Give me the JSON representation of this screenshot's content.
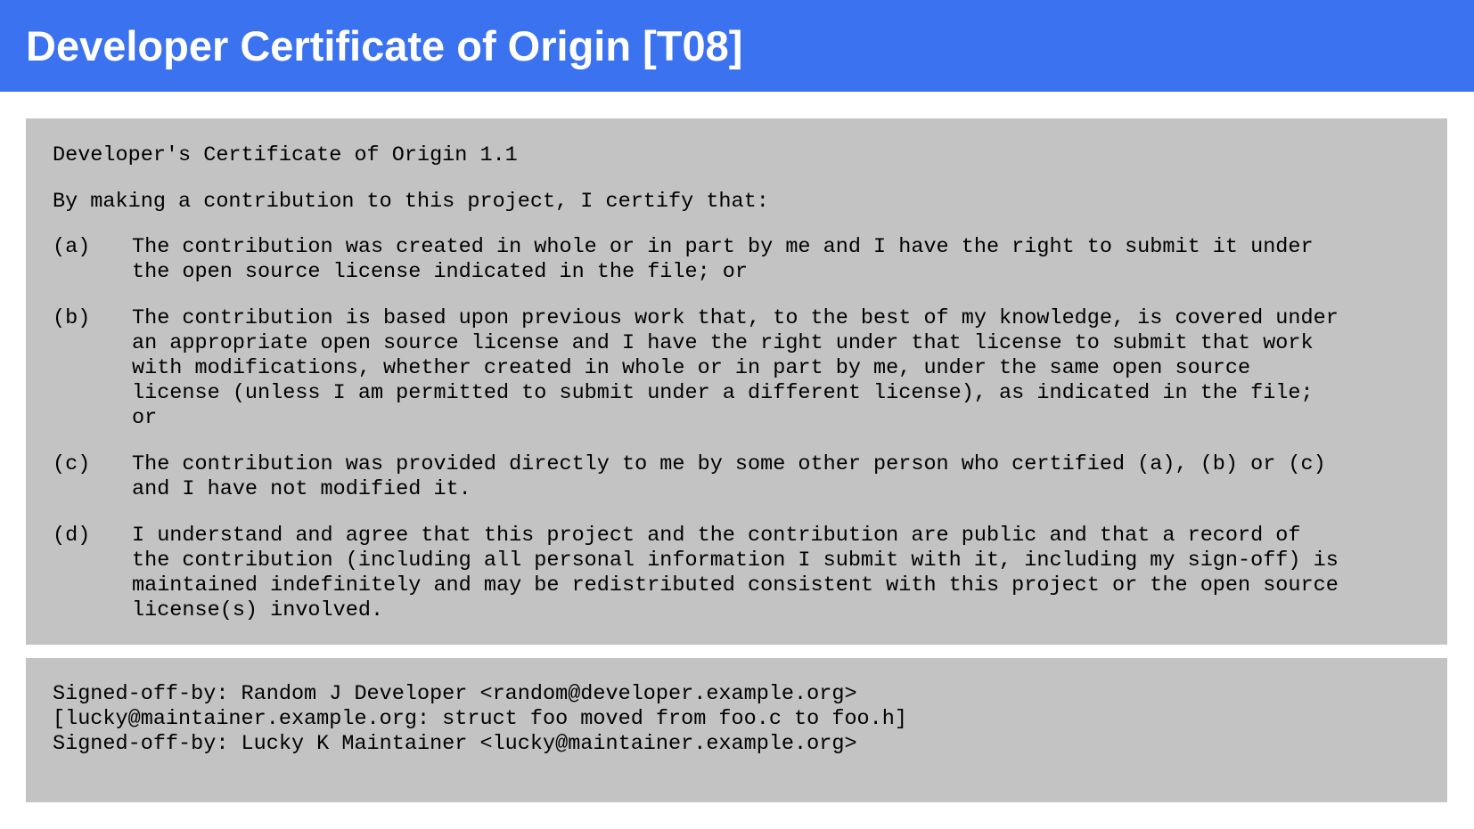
{
  "header": {
    "title": "Developer Certificate of Origin [T08]",
    "background_color": "#3b72f0"
  },
  "certificate": {
    "heading": "Developer's Certificate of Origin 1.1",
    "intro": "By making a contribution to this project, I certify that:",
    "clauses": [
      {
        "label": "(a)",
        "lines": [
          "The contribution was created in whole or in part by me and I have the right to submit it under",
          "the open source license indicated in the file; or"
        ]
      },
      {
        "label": "(b)",
        "lines": [
          "The contribution is based upon previous work that, to the best of my knowledge, is covered under",
          "an appropriate open source license and I have the right under that license to submit that work",
          "with modifications, whether created in whole or in part by me, under the same open source",
          "license (unless I am permitted to submit under a different license), as indicated in the file;",
          "or"
        ]
      },
      {
        "label": "(c)",
        "lines": [
          "The contribution was provided directly to me by some other person who certified (a), (b) or (c)",
          "and I have not modified it."
        ]
      },
      {
        "label": "(d)",
        "lines": [
          "I understand and agree that this project and the contribution are public and that a record of",
          "the contribution (including all personal information I submit with it, including my sign-off) is",
          "maintained indefinitely and may be redistributed consistent with this project or the open source",
          "license(s) involved."
        ]
      }
    ]
  },
  "signoff": {
    "lines": [
      "Signed-off-by: Random J Developer <random@developer.example.org>",
      "[lucky@maintainer.example.org: struct foo moved from foo.c to foo.h]",
      "Signed-off-by: Lucky K Maintainer <lucky@maintainer.example.org>"
    ]
  },
  "colors": {
    "box_background": "#c3c3c3"
  }
}
